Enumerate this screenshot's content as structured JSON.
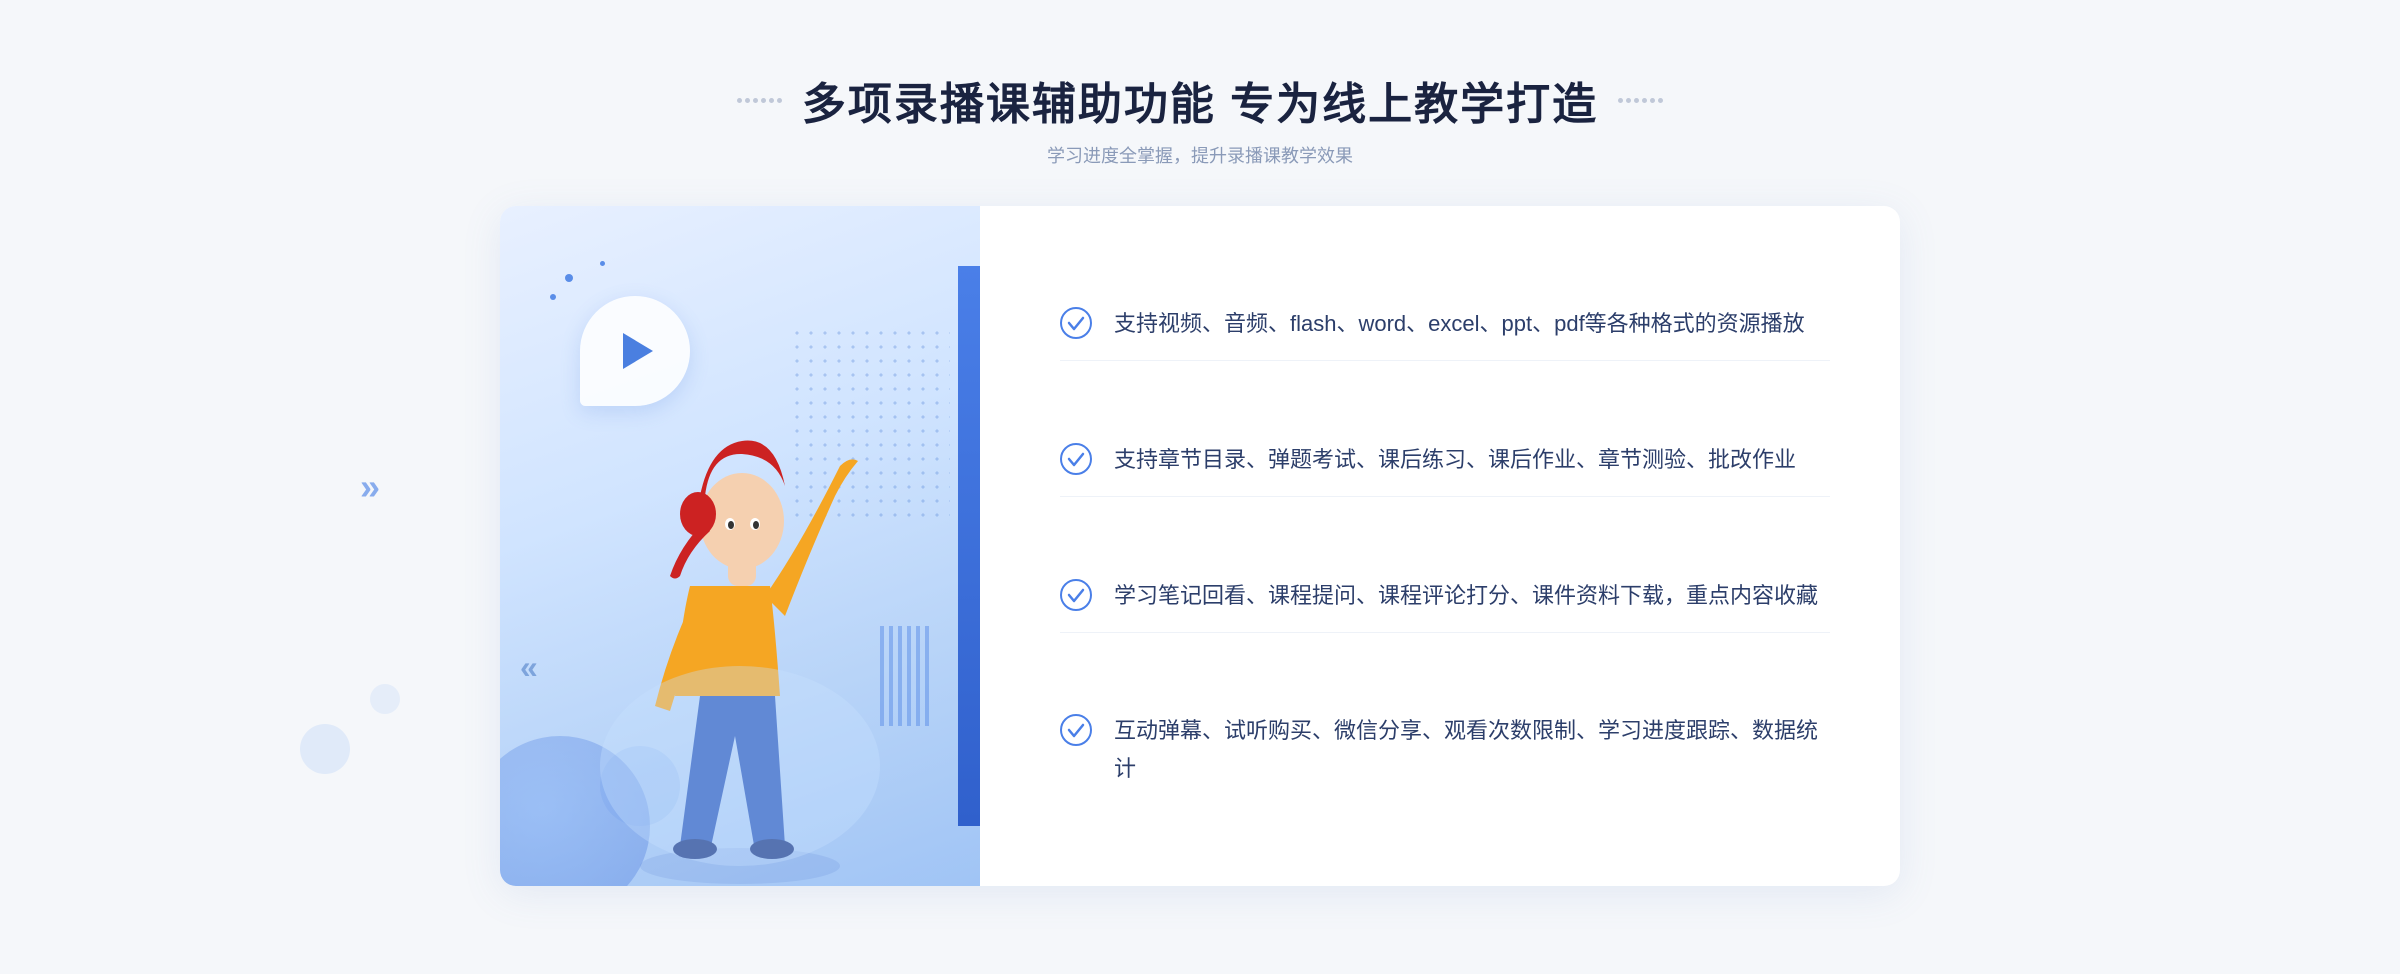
{
  "header": {
    "main_title": "多项录播课辅助功能 专为线上教学打造",
    "subtitle": "学习进度全掌握，提升录播课教学效果"
  },
  "features": [
    {
      "id": 1,
      "text": "支持视频、音频、flash、word、excel、ppt、pdf等各种格式的资源播放"
    },
    {
      "id": 2,
      "text": "支持章节目录、弹题考试、课后练习、课后作业、章节测验、批改作业"
    },
    {
      "id": 3,
      "text": "学习笔记回看、课程提问、课程评论打分、课件资料下载，重点内容收藏"
    },
    {
      "id": 4,
      "text": "互动弹幕、试听购买、微信分享、观看次数限制、学习进度跟踪、数据统计"
    }
  ],
  "icons": {
    "check_circle": "✓",
    "play": "▶",
    "chevron": "»"
  },
  "colors": {
    "primary_blue": "#4a7fe8",
    "title_dark": "#1a2340",
    "text_body": "#2c3e6a",
    "subtitle_gray": "#8a9ab8",
    "accent_blue": "#3060cc"
  }
}
